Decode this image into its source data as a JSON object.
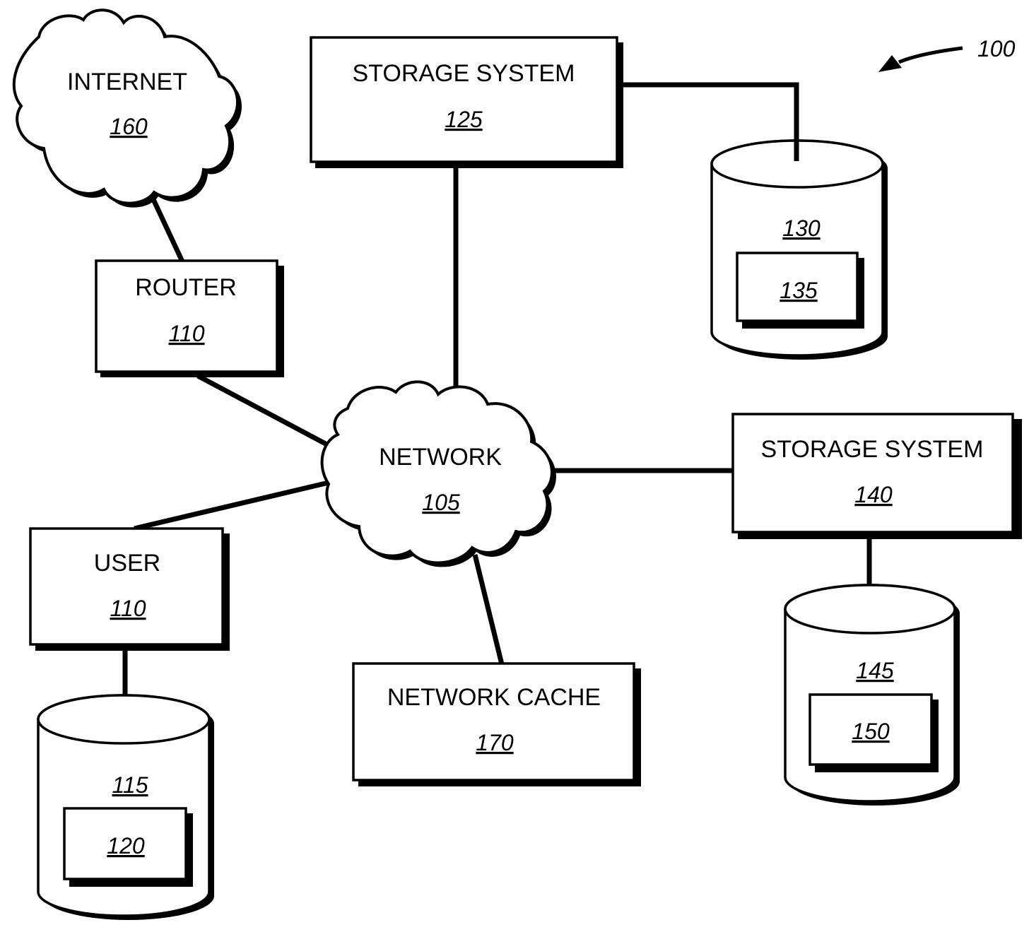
{
  "figure": {
    "ref": "100",
    "nodes": {
      "internet": {
        "label": "INTERNET",
        "ref": "160",
        "shape": "cloud"
      },
      "network": {
        "label": "NETWORK",
        "ref": "105",
        "shape": "cloud"
      },
      "router": {
        "label": "ROUTER",
        "ref": "110",
        "shape": "box"
      },
      "user": {
        "label": "USER",
        "ref": "110",
        "shape": "box"
      },
      "storage_125": {
        "label": "STORAGE SYSTEM",
        "ref": "125",
        "shape": "box"
      },
      "storage_140": {
        "label": "STORAGE SYSTEM",
        "ref": "140",
        "shape": "box"
      },
      "network_cache": {
        "label": "NETWORK CACHE",
        "ref": "170",
        "shape": "box"
      },
      "disk_130": {
        "ref": "130",
        "inner_ref": "135",
        "shape": "cylinder"
      },
      "disk_145": {
        "ref": "145",
        "inner_ref": "150",
        "shape": "cylinder"
      },
      "disk_115": {
        "ref": "115",
        "inner_ref": "120",
        "shape": "cylinder"
      }
    },
    "edges": [
      [
        "internet",
        "router"
      ],
      [
        "router",
        "network"
      ],
      [
        "user",
        "network"
      ],
      [
        "storage_125",
        "network"
      ],
      [
        "storage_140",
        "network"
      ],
      [
        "network_cache",
        "network"
      ],
      [
        "storage_125",
        "disk_130"
      ],
      [
        "storage_140",
        "disk_145"
      ],
      [
        "user",
        "disk_115"
      ]
    ]
  }
}
